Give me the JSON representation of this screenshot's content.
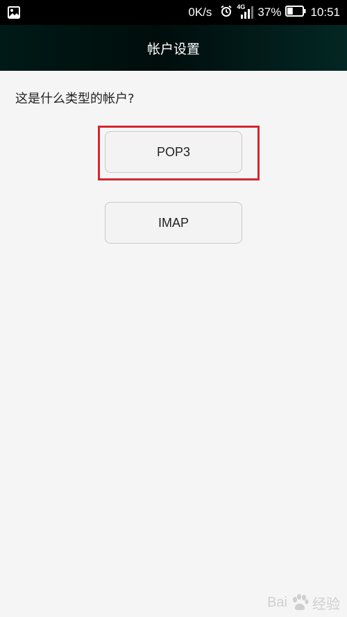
{
  "status_bar": {
    "net_speed": "0K/s",
    "network_type": "4G",
    "battery_percent": "37%",
    "time": "10:51",
    "icons": [
      "image-icon",
      "alarm-icon",
      "signal-icon",
      "battery-icon"
    ]
  },
  "header": {
    "title": "帐户设置"
  },
  "main": {
    "question": "这是什么类型的帐户?",
    "options": [
      {
        "label": "POP3",
        "highlighted": true
      },
      {
        "label": "IMAP",
        "highlighted": false
      }
    ],
    "highlight_color": "#d6262e"
  },
  "watermark": {
    "text_left": "Bai",
    "text_right": "经验"
  }
}
